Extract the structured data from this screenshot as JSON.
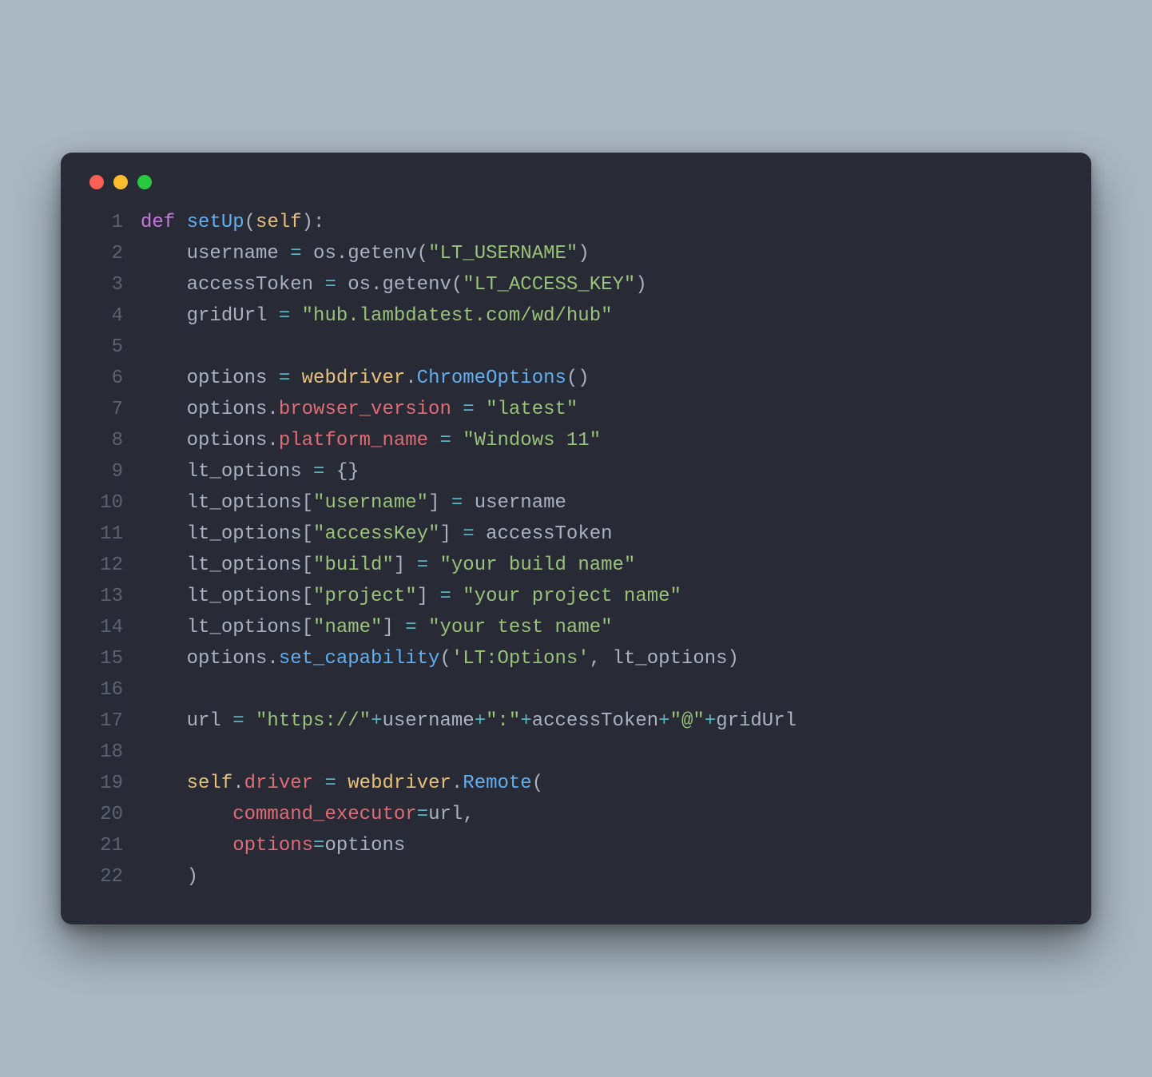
{
  "window": {
    "traffic_lights": [
      "red",
      "yellow",
      "green"
    ]
  },
  "code": {
    "lines": [
      {
        "n": "1",
        "tokens": [
          [
            "kw",
            "def"
          ],
          [
            "id",
            " "
          ],
          [
            "fn",
            "setUp"
          ],
          [
            "id",
            "("
          ],
          [
            "sf",
            "self"
          ],
          [
            "id",
            "):"
          ]
        ]
      },
      {
        "n": "2",
        "tokens": [
          [
            "id",
            "    username "
          ],
          [
            "op",
            "="
          ],
          [
            "id",
            " os.getenv("
          ],
          [
            "str",
            "\"LT_USERNAME\""
          ],
          [
            "id",
            ")"
          ]
        ]
      },
      {
        "n": "3",
        "tokens": [
          [
            "id",
            "    accessToken "
          ],
          [
            "op",
            "="
          ],
          [
            "id",
            " os.getenv("
          ],
          [
            "str",
            "\"LT_ACCESS_KEY\""
          ],
          [
            "id",
            ")"
          ]
        ]
      },
      {
        "n": "4",
        "tokens": [
          [
            "id",
            "    gridUrl "
          ],
          [
            "op",
            "="
          ],
          [
            "id",
            " "
          ],
          [
            "str",
            "\"hub.lambdatest.com/wd/hub\""
          ]
        ]
      },
      {
        "n": "5",
        "tokens": [
          [
            "id",
            ""
          ]
        ]
      },
      {
        "n": "6",
        "tokens": [
          [
            "id",
            "    options "
          ],
          [
            "op",
            "="
          ],
          [
            "id",
            " "
          ],
          [
            "cls",
            "webdriver"
          ],
          [
            "id",
            "."
          ],
          [
            "fn",
            "ChromeOptions"
          ],
          [
            "id",
            "()"
          ]
        ]
      },
      {
        "n": "7",
        "tokens": [
          [
            "id",
            "    options."
          ],
          [
            "nm",
            "browser_version"
          ],
          [
            "id",
            " "
          ],
          [
            "op",
            "="
          ],
          [
            "id",
            " "
          ],
          [
            "str",
            "\"latest\""
          ]
        ]
      },
      {
        "n": "8",
        "tokens": [
          [
            "id",
            "    options."
          ],
          [
            "nm",
            "platform_name"
          ],
          [
            "id",
            " "
          ],
          [
            "op",
            "="
          ],
          [
            "id",
            " "
          ],
          [
            "str",
            "\"Windows 11\""
          ]
        ]
      },
      {
        "n": "9",
        "tokens": [
          [
            "id",
            "    lt_options "
          ],
          [
            "op",
            "="
          ],
          [
            "id",
            " {}"
          ]
        ]
      },
      {
        "n": "10",
        "tokens": [
          [
            "id",
            "    lt_options["
          ],
          [
            "str",
            "\"username\""
          ],
          [
            "id",
            "] "
          ],
          [
            "op",
            "="
          ],
          [
            "id",
            " username"
          ]
        ]
      },
      {
        "n": "11",
        "tokens": [
          [
            "id",
            "    lt_options["
          ],
          [
            "str",
            "\"accessKey\""
          ],
          [
            "id",
            "] "
          ],
          [
            "op",
            "="
          ],
          [
            "id",
            " accessToken"
          ]
        ]
      },
      {
        "n": "12",
        "tokens": [
          [
            "id",
            "    lt_options["
          ],
          [
            "str",
            "\"build\""
          ],
          [
            "id",
            "] "
          ],
          [
            "op",
            "="
          ],
          [
            "id",
            " "
          ],
          [
            "str",
            "\"your build name\""
          ]
        ]
      },
      {
        "n": "13",
        "tokens": [
          [
            "id",
            "    lt_options["
          ],
          [
            "str",
            "\"project\""
          ],
          [
            "id",
            "] "
          ],
          [
            "op",
            "="
          ],
          [
            "id",
            " "
          ],
          [
            "str",
            "\"your project name\""
          ]
        ]
      },
      {
        "n": "14",
        "tokens": [
          [
            "id",
            "    lt_options["
          ],
          [
            "str",
            "\"name\""
          ],
          [
            "id",
            "] "
          ],
          [
            "op",
            "="
          ],
          [
            "id",
            " "
          ],
          [
            "str",
            "\"your test name\""
          ]
        ]
      },
      {
        "n": "15",
        "tokens": [
          [
            "id",
            "    options."
          ],
          [
            "fn",
            "set_capability"
          ],
          [
            "id",
            "("
          ],
          [
            "str",
            "'LT:Options'"
          ],
          [
            "id",
            ", lt_options)"
          ]
        ]
      },
      {
        "n": "16",
        "tokens": [
          [
            "id",
            ""
          ]
        ]
      },
      {
        "n": "17",
        "tokens": [
          [
            "id",
            "    url "
          ],
          [
            "op",
            "="
          ],
          [
            "id",
            " "
          ],
          [
            "str",
            "\"https://\""
          ],
          [
            "op",
            "+"
          ],
          [
            "id",
            "username"
          ],
          [
            "op",
            "+"
          ],
          [
            "str",
            "\":\""
          ],
          [
            "op",
            "+"
          ],
          [
            "id",
            "accessToken"
          ],
          [
            "op",
            "+"
          ],
          [
            "str",
            "\"@\""
          ],
          [
            "op",
            "+"
          ],
          [
            "id",
            "gridUrl"
          ]
        ]
      },
      {
        "n": "18",
        "tokens": [
          [
            "id",
            ""
          ]
        ]
      },
      {
        "n": "19",
        "tokens": [
          [
            "id",
            "    "
          ],
          [
            "sf",
            "self"
          ],
          [
            "id",
            "."
          ],
          [
            "nm",
            "driver"
          ],
          [
            "id",
            " "
          ],
          [
            "op",
            "="
          ],
          [
            "id",
            " "
          ],
          [
            "cls",
            "webdriver"
          ],
          [
            "id",
            "."
          ],
          [
            "fn",
            "Remote"
          ],
          [
            "id",
            "("
          ]
        ]
      },
      {
        "n": "20",
        "tokens": [
          [
            "id",
            "        "
          ],
          [
            "nm",
            "command_executor"
          ],
          [
            "op",
            "="
          ],
          [
            "id",
            "url,"
          ]
        ]
      },
      {
        "n": "21",
        "tokens": [
          [
            "id",
            "        "
          ],
          [
            "nm",
            "options"
          ],
          [
            "op",
            "="
          ],
          [
            "id",
            "options"
          ]
        ]
      },
      {
        "n": "22",
        "tokens": [
          [
            "id",
            "    )"
          ]
        ]
      }
    ]
  }
}
